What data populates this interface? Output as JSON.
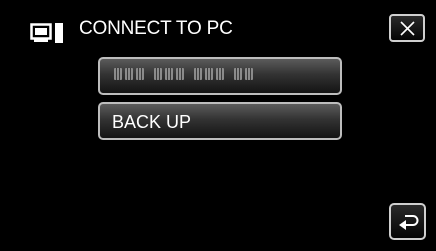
{
  "header": {
    "title": "CONNECT TO PC",
    "icon": "pc-connection-icon"
  },
  "close": {
    "icon": "close-icon"
  },
  "menu": {
    "items": [
      {
        "label": "",
        "masked": true
      },
      {
        "label": "BACK UP"
      }
    ]
  },
  "footer": {
    "back_icon": "return-icon"
  }
}
